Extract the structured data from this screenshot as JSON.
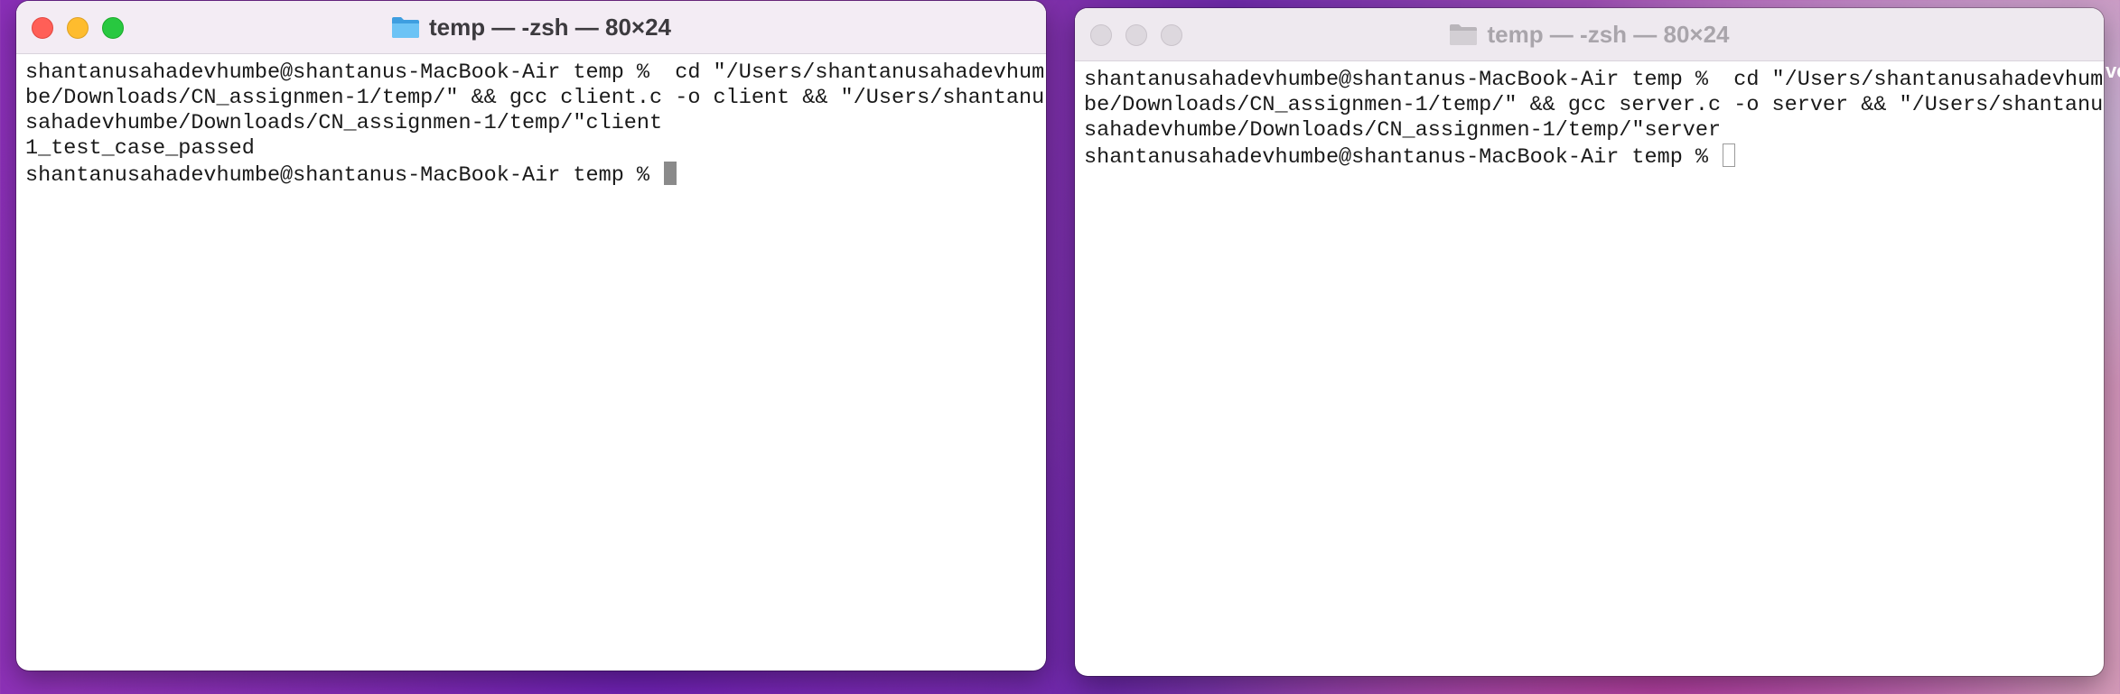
{
  "windows": {
    "client": {
      "title": "temp — -zsh — 80×24",
      "lines": [
        "shantanusahadevhumbe@shantanus-MacBook-Air temp %  cd \"/Users/shantanusahadevhum",
        "be/Downloads/CN_assignmen-1/temp/\" && gcc client.c -o client && \"/Users/shantanu",
        "sahadevhumbe/Downloads/CN_assignmen-1/temp/\"client",
        "1_test_case_passed"
      ],
      "prompt": "shantanusahadevhumbe@shantanus-MacBook-Air temp % "
    },
    "server": {
      "title": "temp — -zsh — 80×24",
      "lines": [
        "shantanusahadevhumbe@shantanus-MacBook-Air temp %  cd \"/Users/shantanusahadevhum",
        "be/Downloads/CN_assignmen-1/temp/\" && gcc server.c -o server && \"/Users/shantanu",
        "sahadevhumbe/Downloads/CN_assignmen-1/temp/\"server"
      ],
      "prompt": "shantanusahadevhumbe@shantanus-MacBook-Air temp % "
    }
  },
  "background_peek_text": "ve",
  "icons": {
    "window_controls": [
      "close-icon",
      "minimize-icon",
      "maximize-icon"
    ],
    "title_icon": "folder-icon"
  },
  "colors": {
    "close": "#ff5f57",
    "minimize": "#febc2e",
    "maximize": "#28c840",
    "folder_active": "#5ab4f0",
    "folder_inactive": "#c8c4c9"
  }
}
